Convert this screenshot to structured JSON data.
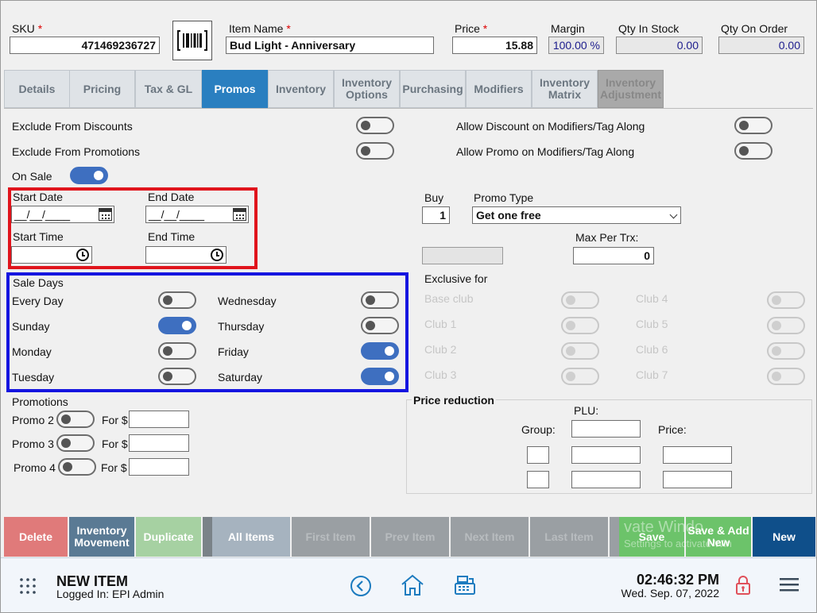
{
  "header": {
    "sku_label": "SKU",
    "sku_value": "471469236727",
    "item_name_label": "Item Name",
    "item_name_value": "Bud Light - Anniversary",
    "price_label": "Price",
    "price_value": "15.88",
    "margin_label": "Margin",
    "margin_value": "100.00 %",
    "qty_stock_label": "Qty In Stock",
    "qty_stock_value": "0.00",
    "qty_order_label": "Qty On Order",
    "qty_order_value": "0.00",
    "required_mark": "*",
    "barcode_icon": "barcode-icon"
  },
  "tabs": [
    {
      "label": "Details"
    },
    {
      "label": "Pricing"
    },
    {
      "label": "Tax & GL"
    },
    {
      "label": "Promos",
      "active": true
    },
    {
      "label": "Inventory"
    },
    {
      "label": "Inventory Options"
    },
    {
      "label": "Purchasing"
    },
    {
      "label": "Modifiers"
    },
    {
      "label": "Inventory Matrix"
    },
    {
      "label": "Inventory Adjustment",
      "disabled": true
    }
  ],
  "promos": {
    "exclude_discounts_label": "Exclude From Discounts",
    "exclude_discounts_on": false,
    "exclude_promotions_label": "Exclude From Promotions",
    "exclude_promotions_on": false,
    "allow_discount_mod_label": "Allow Discount on Modifiers/Tag Along",
    "allow_discount_mod_on": false,
    "allow_promo_mod_label": "Allow Promo on Modifiers/Tag Along",
    "allow_promo_mod_on": false,
    "on_sale_label": "On Sale",
    "on_sale_on": true,
    "start_date_label": "Start Date",
    "start_date_value": "__/__/____",
    "end_date_label": "End Date",
    "end_date_value": "__/__/____",
    "start_time_label": "Start Time",
    "end_time_label": "End Time",
    "sale_days_label": "Sale Days",
    "days": {
      "every_day": {
        "label": "Every Day",
        "on": false
      },
      "sunday": {
        "label": "Sunday",
        "on": true
      },
      "monday": {
        "label": "Monday",
        "on": false
      },
      "tuesday": {
        "label": "Tuesday",
        "on": false
      },
      "wednesday": {
        "label": "Wednesday",
        "on": false
      },
      "thursday": {
        "label": "Thursday",
        "on": false
      },
      "friday": {
        "label": "Friday",
        "on": true
      },
      "saturday": {
        "label": "Saturday",
        "on": true
      }
    },
    "promotions_label": "Promotions",
    "promo_rows": [
      {
        "label": "Promo 2",
        "for_label": "For $",
        "value": ""
      },
      {
        "label": "Promo 3",
        "for_label": "For $",
        "value": ""
      },
      {
        "label": "Promo 4",
        "for_label": "For $",
        "value": ""
      }
    ],
    "buy_label": "Buy",
    "buy_value": "1",
    "promo_type_label": "Promo Type",
    "promo_type_value": "Get one free",
    "max_per_trx_label": "Max Per Trx:",
    "max_per_trx_value": "0",
    "exclusive_for_label": "Exclusive for",
    "clubs": [
      {
        "label": "Base club"
      },
      {
        "label": "Club 4"
      },
      {
        "label": "Club 1"
      },
      {
        "label": "Club 5"
      },
      {
        "label": "Club 2"
      },
      {
        "label": "Club 6"
      },
      {
        "label": "Club 3"
      },
      {
        "label": "Club 7"
      }
    ],
    "price_reduction_label": "Price reduction",
    "plu_label": "PLU:",
    "group_label": "Group:",
    "price_label": "Price:"
  },
  "bottom_bar": {
    "delete": "Delete",
    "inventory_movement": "Inventory Movement",
    "duplicate": "Duplicate",
    "all_items": "All Items",
    "first_item": "First Item",
    "prev_item": "Prev Item",
    "next_item": "Next Item",
    "last_item": "Last Item",
    "save": "Save",
    "save_add_new": "Save & Add New",
    "new": "New",
    "watermark_line1": "vate Windo",
    "watermark_line2": "Settings to activate Win"
  },
  "footer": {
    "title": "NEW ITEM",
    "logged_in": "Logged In:  EPI Admin",
    "time": "02:46:32 PM",
    "date": "Wed. Sep. 07, 2022"
  },
  "colors": {
    "accent": "#2a7fc0",
    "toggle_on": "#3e6fc0",
    "delete": "#e07a7a",
    "inventory_movement": "#5a7a94",
    "duplicate": "#a6d1a2",
    "all_items": "#a6b3bf",
    "nav_disabled": "#9a9fa3",
    "save": "#6cc36a",
    "new": "#0f4f8a",
    "red_box": "#e0141c",
    "blue_box": "#1515e0"
  }
}
